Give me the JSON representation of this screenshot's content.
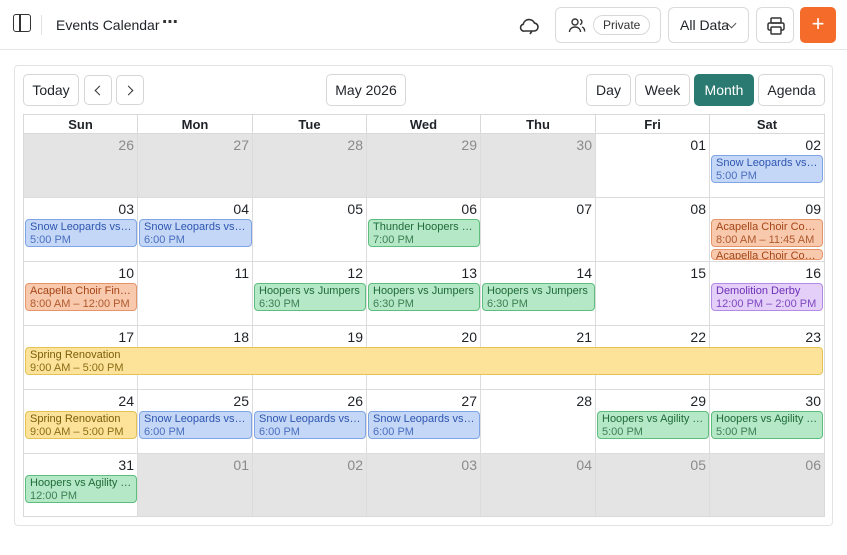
{
  "topbar": {
    "title": "Events Calendar",
    "more": "⋯",
    "private_label": "Private",
    "data_filter": "All Data",
    "add_label": "+"
  },
  "toolbar": {
    "today": "Today",
    "month_label": "May 2026",
    "views": {
      "day": "Day",
      "week": "Week",
      "month": "Month",
      "agenda": "Agenda"
    },
    "active_view": "month"
  },
  "colors": {
    "accent": "#2b7a72",
    "add_button": "#f56b2a",
    "blue": "#c4d7f7",
    "green": "#b5e8c6",
    "orange": "#f8c9ad",
    "purple": "#e3cff7",
    "yellow": "#fde39a"
  },
  "weekdays": [
    "Sun",
    "Mon",
    "Tue",
    "Wed",
    "Thu",
    "Fri",
    "Sat"
  ],
  "weeks": [
    [
      "26",
      "27",
      "28",
      "29",
      "30",
      "01",
      "02"
    ],
    [
      "03",
      "04",
      "05",
      "06",
      "07",
      "08",
      "09"
    ],
    [
      "10",
      "11",
      "12",
      "13",
      "14",
      "15",
      "16"
    ],
    [
      "17",
      "18",
      "19",
      "20",
      "21",
      "22",
      "23"
    ],
    [
      "24",
      "25",
      "26",
      "27",
      "28",
      "29",
      "30"
    ],
    [
      "31",
      "01",
      "02",
      "03",
      "04",
      "05",
      "06"
    ]
  ],
  "events": [
    {
      "week": 0,
      "day": 6,
      "title": "Snow Leopards vs. Lions",
      "time": "5:00 PM",
      "color": "blue"
    },
    {
      "week": 1,
      "day": 0,
      "title": "Snow Leopards vs. Lions",
      "time": "5:00 PM",
      "color": "blue"
    },
    {
      "week": 1,
      "day": 1,
      "title": "Snow Leopards vs. Lions",
      "time": "6:00 PM",
      "color": "blue"
    },
    {
      "week": 1,
      "day": 3,
      "title": "Thunder Hoopers vs. Jumpers",
      "time": "7:00 PM",
      "color": "green"
    },
    {
      "week": 1,
      "day": 6,
      "title": "Acapella Choir Competition",
      "time": "8:00 AM – 11:45 AM",
      "color": "orange"
    },
    {
      "week": 1,
      "day": 6,
      "title": "Acapella Choir Competition",
      "time": "",
      "color": "orange",
      "row": 1
    },
    {
      "week": 2,
      "day": 0,
      "title": "Acapella Choir Finals",
      "time": "8:00 AM – 12:00 PM",
      "color": "orange"
    },
    {
      "week": 2,
      "day": 2,
      "title": "Hoopers vs Jumpers",
      "time": "6:30 PM",
      "color": "green"
    },
    {
      "week": 2,
      "day": 3,
      "title": "Hoopers vs Jumpers",
      "time": "6:30 PM",
      "color": "green"
    },
    {
      "week": 2,
      "day": 4,
      "title": "Hoopers vs Jumpers",
      "time": "6:30 PM",
      "color": "green"
    },
    {
      "week": 2,
      "day": 6,
      "title": "Demolition Derby",
      "time": "12:00 PM – 2:00 PM",
      "color": "purple"
    },
    {
      "week": 3,
      "day": 0,
      "span": 7,
      "title": "Spring Renovation",
      "time": "9:00 AM – 5:00 PM",
      "color": "yellow"
    },
    {
      "week": 4,
      "day": 0,
      "title": "Spring Renovation",
      "time": "9:00 AM – 5:00 PM",
      "color": "yellow"
    },
    {
      "week": 4,
      "day": 1,
      "title": "Snow Leopards vs. Lions",
      "time": "6:00 PM",
      "color": "blue"
    },
    {
      "week": 4,
      "day": 2,
      "title": "Snow Leopards vs. Lions",
      "time": "6:00 PM",
      "color": "blue"
    },
    {
      "week": 4,
      "day": 3,
      "title": "Snow Leopards vs. Lions",
      "time": "6:00 PM",
      "color": "blue"
    },
    {
      "week": 4,
      "day": 5,
      "title": "Hoopers vs Agility Team",
      "time": "5:00 PM",
      "color": "green"
    },
    {
      "week": 4,
      "day": 6,
      "title": "Hoopers vs Agility Team",
      "time": "5:00 PM",
      "color": "green"
    },
    {
      "week": 5,
      "day": 0,
      "title": "Hoopers vs Agility Team",
      "time": "12:00 PM",
      "color": "green"
    }
  ]
}
